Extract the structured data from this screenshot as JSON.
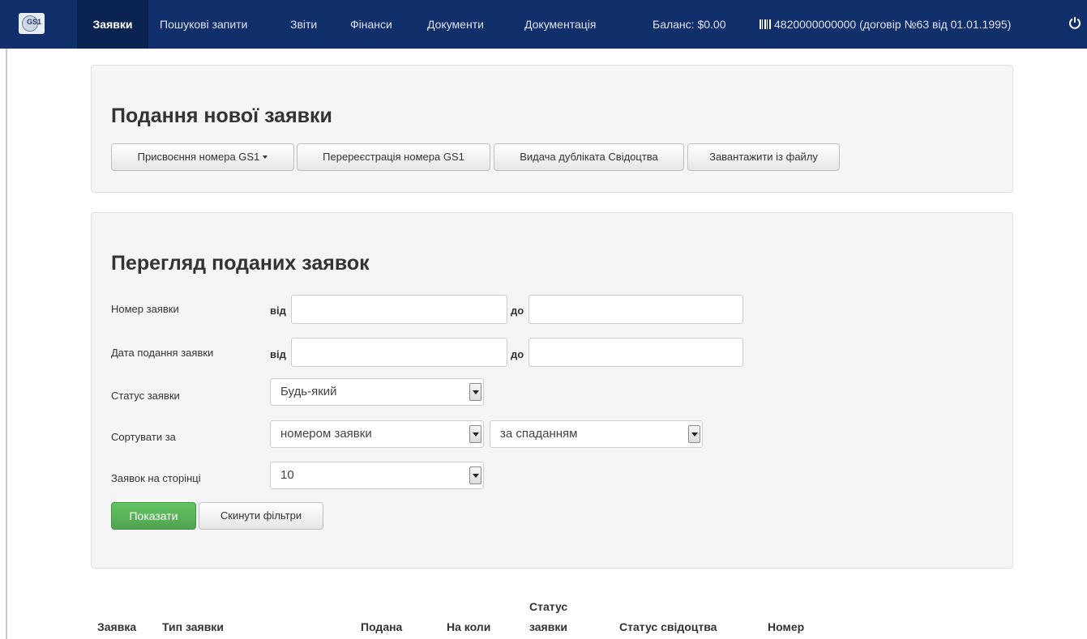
{
  "navbar": {
    "logo_text": "GS1",
    "items": [
      {
        "label": "Заявки",
        "active": true
      },
      {
        "label": "Пошукові запити"
      },
      {
        "label": "Звіти"
      },
      {
        "label": "Фінанси"
      },
      {
        "label": "Документи"
      },
      {
        "label": "Документація"
      }
    ],
    "balance": "Баланс: $0.00",
    "account": "4820000000000 (договір №63 від 01.01.1995)",
    "icons": {
      "account": "barcode-icon",
      "logout": "power-icon"
    },
    "colors": {
      "background": "#11306b",
      "active": "#0a2350"
    }
  },
  "new_request": {
    "title": "Подання нової заявки",
    "buttons": {
      "assign": "Присвоєння номера GS1",
      "reregister": "Перереєстрація номера GS1",
      "duplicate": "Видача дубліката Свідоцтва",
      "upload": "Завантажити із файлу"
    }
  },
  "filters": {
    "title": "Перегляд поданих заявок",
    "request_number": {
      "label": "Номер заявки",
      "from": "від",
      "to": "до",
      "from_value": "",
      "to_value": ""
    },
    "request_date": {
      "label": "Дата подання заявки",
      "from": "від",
      "to": "до",
      "from_value": "",
      "to_value": ""
    },
    "status": {
      "label": "Статус заявки",
      "selected": "Будь-який"
    },
    "sort": {
      "label": "Сортувати за",
      "field": "номером заявки",
      "direction": "за спаданням"
    },
    "per_page": {
      "label": "Заявок на сторінці",
      "selected": "10"
    },
    "show_button": "Показати",
    "reset_button": "Скинути фільтри",
    "colors": {
      "show_button": "#5cb85c"
    }
  },
  "table": {
    "headers": {
      "request": "Заявка",
      "type": "Тип заявки",
      "submitted": "Подана",
      "when": "На коли",
      "status_line1": "Статус",
      "status_line2": "заявки",
      "certificate": "Статус свідоцтва",
      "number": "Номер"
    }
  }
}
